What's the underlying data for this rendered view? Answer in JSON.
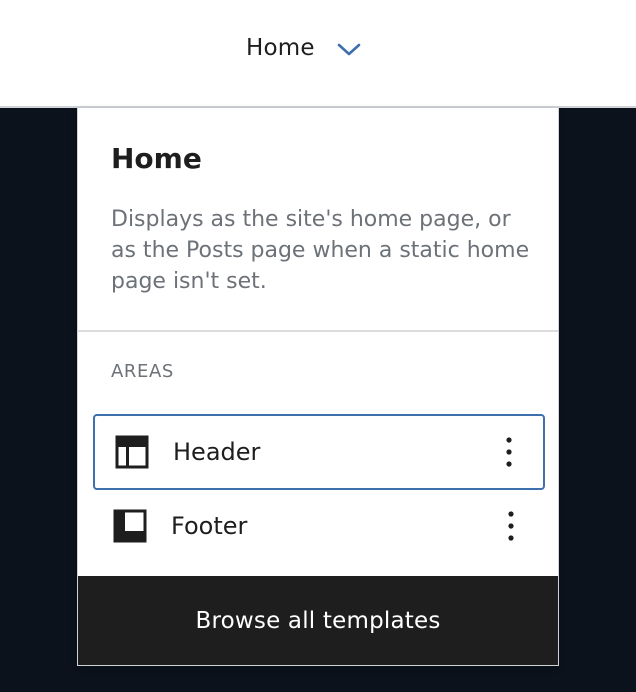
{
  "topbar": {
    "title": "Home",
    "chevron_icon": "chevron-down-icon",
    "accent_color": "#3d70ad"
  },
  "popover": {
    "title": "Home",
    "description": "Displays as the site's home page, or as the Posts page when a static home page isn't set.",
    "areas_heading": "AREAS",
    "areas": [
      {
        "label": "Header",
        "icon": "header-layout-icon",
        "selected": true
      },
      {
        "label": "Footer",
        "icon": "footer-layout-icon",
        "selected": false
      }
    ],
    "more_icon": "more-vertical-icon",
    "browse_label": "Browse all templates"
  }
}
